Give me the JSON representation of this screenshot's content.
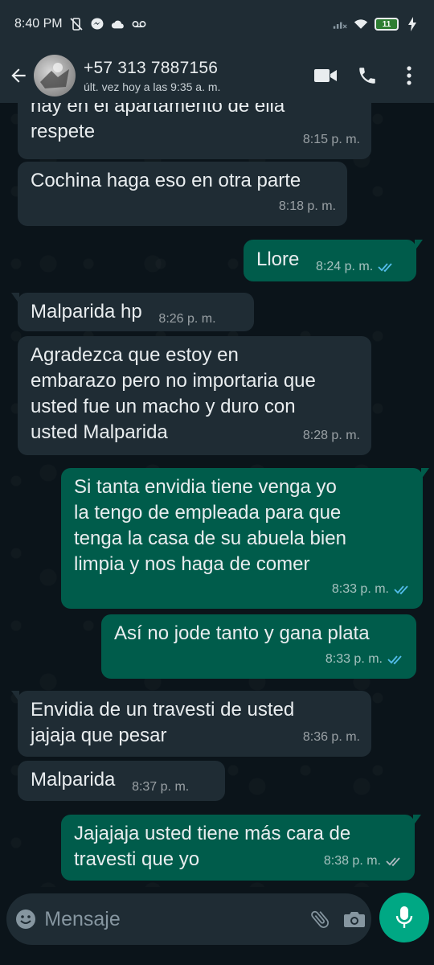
{
  "status_bar": {
    "time": "8:40 PM",
    "battery": "11"
  },
  "header": {
    "contact_name": "+57 313 7887156",
    "last_seen": "últ. vez hoy a las 9:35 a. m."
  },
  "messages": [
    {
      "dir": "in",
      "text": "hay en el apartamento de ella\nrespete",
      "time": "8:15 p. m."
    },
    {
      "dir": "in",
      "text": "Cochina haga eso en otra parte",
      "time": "8:18 p. m."
    },
    {
      "dir": "out",
      "text": "Llore",
      "time": "8:24 p. m.",
      "ticks": "read"
    },
    {
      "dir": "in",
      "text": "Malparida hp",
      "time": "8:26 p. m."
    },
    {
      "dir": "in",
      "text": "Agradezca que estoy en\nembarazo pero no importaria que\nusted fue un macho y duro con\nusted Malparida",
      "time": "8:28 p. m."
    },
    {
      "dir": "out",
      "text": "Si tanta envidia tiene venga yo\nla tengo de empleada para que\ntenga la casa de su abuela bien\nlimpia y nos haga de comer",
      "time": "8:33 p. m.",
      "ticks": "read"
    },
    {
      "dir": "out",
      "text": "Así no jode tanto y gana plata",
      "time": "8:33 p. m.",
      "ticks": "read"
    },
    {
      "dir": "in",
      "text": "Envidia de un travesti de usted\njajaja que pesar",
      "time": "8:36 p. m."
    },
    {
      "dir": "in",
      "text": "Malparida",
      "time": "8:37 p. m."
    },
    {
      "dir": "out",
      "text": "Jajajaja usted tiene más cara de\ntravesti que yo",
      "time": "8:38 p. m.",
      "ticks": "delivered"
    }
  ],
  "composer": {
    "placeholder": "Mensaje"
  },
  "colors": {
    "background": "#0b141a",
    "incoming_bubble": "#1f2c34",
    "outgoing_bubble": "#005c4b",
    "read_tick": "#53bdeb",
    "accent": "#00a884"
  },
  "icons": {
    "back": "arrow-left-icon",
    "video": "video-call-icon",
    "call": "phone-icon",
    "menu": "more-vertical-icon",
    "emoji": "emoji-icon",
    "attach": "paperclip-icon",
    "camera": "camera-icon",
    "mic": "microphone-icon"
  }
}
